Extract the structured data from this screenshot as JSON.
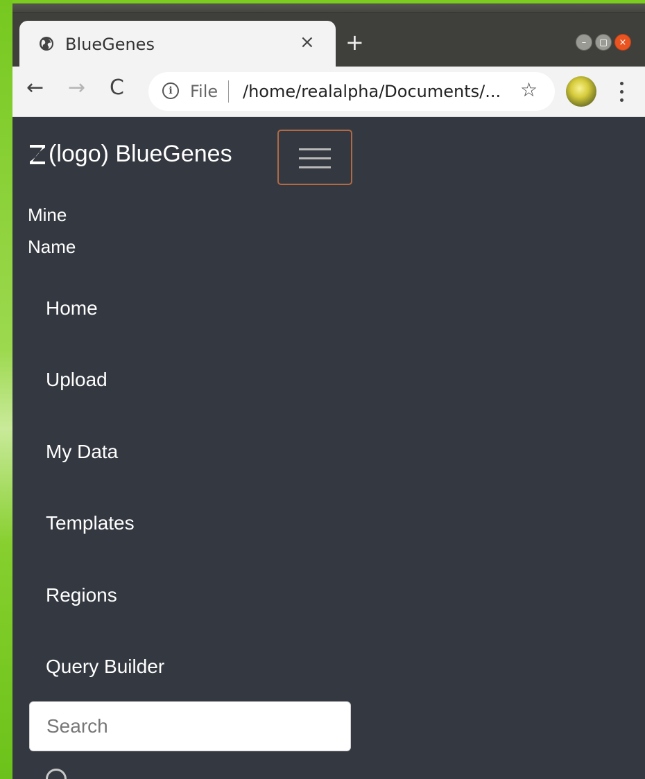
{
  "browser": {
    "tab": {
      "title": "BlueGenes",
      "close_glyph": "×",
      "icon": "globe-icon"
    },
    "new_tab_glyph": "+",
    "window_controls": {
      "minimize_glyph": "–",
      "maximize_glyph": "▢",
      "close_glyph": "×",
      "close_color": "#e95420"
    },
    "toolbar": {
      "back_glyph": "←",
      "forward_glyph": "→",
      "reload_glyph": "C",
      "info_glyph": "i",
      "scheme_label": "File",
      "url": "/home/realalpha/Documents/...",
      "star_glyph": "☆"
    }
  },
  "app": {
    "brand_text": "(logo) BlueGenes",
    "mine_name": "Mine Name",
    "toggler_border_color": "#b06a45",
    "nav": [
      {
        "label": "Home"
      },
      {
        "label": "Upload"
      },
      {
        "label": "My Data"
      },
      {
        "label": "Templates"
      },
      {
        "label": "Regions"
      },
      {
        "label": "Query Builder"
      }
    ],
    "search": {
      "placeholder": "Search"
    },
    "background_color": "#343840"
  }
}
